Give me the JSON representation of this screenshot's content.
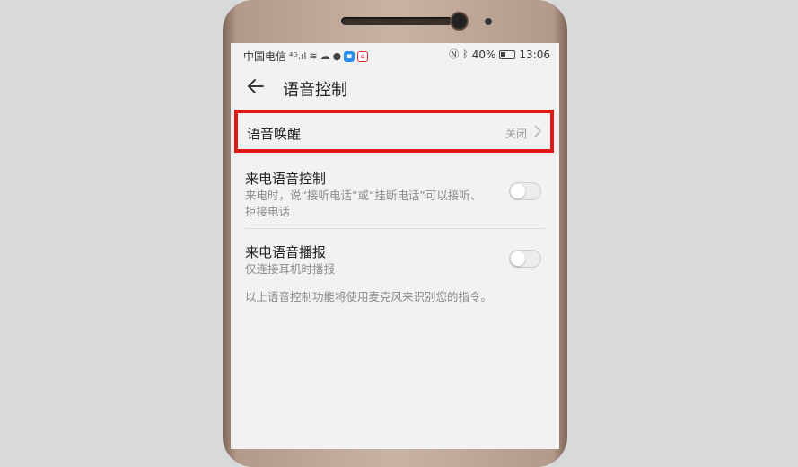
{
  "status_bar": {
    "carrier": "中国电信",
    "signal": "⁴ᴳ.ıl",
    "battery_percent": "40%",
    "time": "13:06"
  },
  "header": {
    "title": "语音控制"
  },
  "voice_wake": {
    "label": "语音唤醒",
    "value": "关闭"
  },
  "call_voice_control": {
    "title": "来电语音控制",
    "description": "来电时，说“接听电话”或“挂断电话”可以接听、拒接电话",
    "enabled": false
  },
  "call_voice_announce": {
    "title": "来电语音播报",
    "description": "仅连接耳机时播报",
    "enabled": false
  },
  "footnote": "以上语音控制功能将使用麦克风来识别您的指令。",
  "colors": {
    "highlight": "#e01818",
    "background": "#f2f2f2",
    "phone_frame": "#c9b3a3"
  }
}
